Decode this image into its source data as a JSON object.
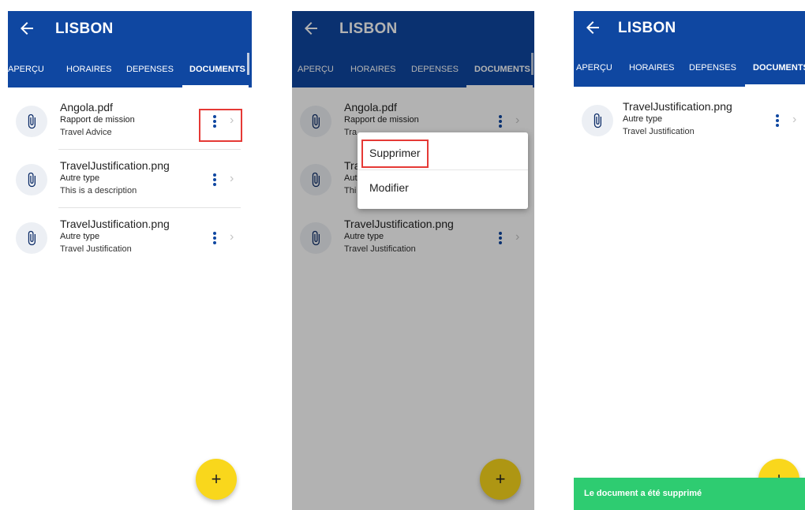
{
  "colors": {
    "primary": "#0f47a1",
    "fab": "#f9d71c",
    "snackbar": "#2ecc71",
    "highlight": "#e53935",
    "kebab": "#0f47a1"
  },
  "icons": {
    "back": "arrow-left-icon",
    "file": "paperclip-icon",
    "more": "more-vertical-icon",
    "chevron": "chevron-right-icon",
    "add": "plus-icon"
  },
  "screens": [
    {
      "title": "LISBON",
      "tabs": [
        "APERÇU",
        "HORAIRES",
        "DEPENSES",
        "DOCUMENTS"
      ],
      "active_tab": "DOCUMENTS",
      "documents": [
        {
          "name": "Angola.pdf",
          "type": "Rapport de mission",
          "description": "Travel Advice"
        },
        {
          "name": "TravelJustification.png",
          "type": "Autre type",
          "description": "This is a description"
        },
        {
          "name": "TravelJustification.png",
          "type": "Autre type",
          "description": "Travel Justification"
        }
      ],
      "fab_label": "+"
    },
    {
      "title": "LISBON",
      "tabs": [
        "APERÇU",
        "HORAIRES",
        "DEPENSES",
        "DOCUMENTS"
      ],
      "active_tab": "DOCUMENTS",
      "documents": [
        {
          "name": "Angola.pdf",
          "type": "Rapport de mission",
          "description": "Tra"
        },
        {
          "name": "Tra",
          "type": "Aut",
          "description": "Thi"
        },
        {
          "name": "TravelJustification.png",
          "type": "Autre type",
          "description": "Travel Justification"
        }
      ],
      "menu": [
        "Supprimer",
        "Modifier"
      ],
      "fab_label": "+"
    },
    {
      "title": "LISBON",
      "tabs": [
        "APERÇU",
        "HORAIRES",
        "DEPENSES",
        "DOCUMENTS"
      ],
      "active_tab": "DOCUMENTS",
      "documents": [
        {
          "name": "TravelJustification.png",
          "type": "Autre type",
          "description": "Travel Justification"
        }
      ],
      "fab_label": "+",
      "snackbar": "Le document a été supprimé"
    }
  ]
}
